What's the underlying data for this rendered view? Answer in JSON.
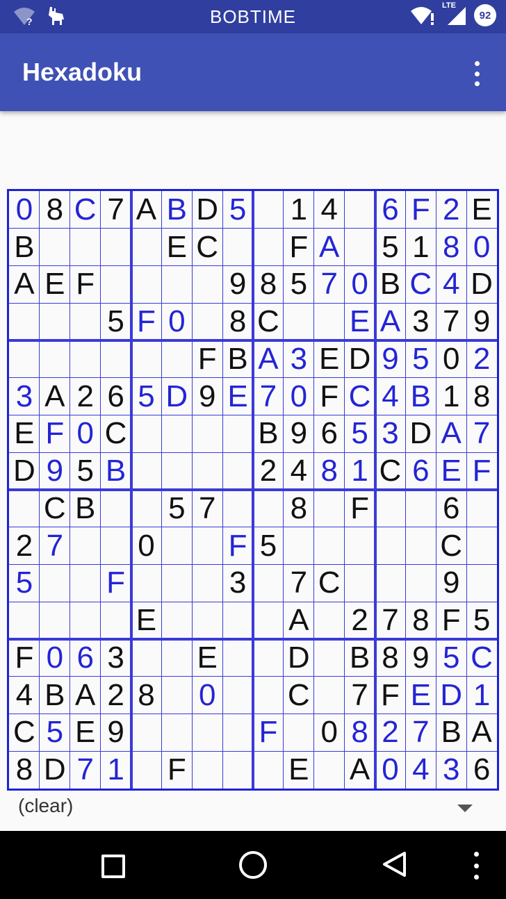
{
  "status_bar": {
    "title": "BOBTIME",
    "lte": "LTE",
    "battery": "92"
  },
  "app_bar": {
    "title": "Hexadoku"
  },
  "selector": {
    "value": "(clear)"
  },
  "colors": {
    "status_bar": "#303f9f",
    "app_bar": "#3f51b5",
    "grid": "#1e22d8",
    "given_digit": "#111111",
    "user_digit": "#2424d6"
  },
  "grid": {
    "size": 16,
    "box": 4,
    "rows": [
      [
        "0u",
        "8",
        "Cu",
        "7",
        "A",
        "Bu",
        "D",
        "5u",
        "",
        "1",
        "4",
        "",
        "6u",
        "Fu",
        "2u",
        "E"
      ],
      [
        "B",
        "",
        "",
        "",
        "",
        "E",
        "C",
        "",
        "",
        "F",
        "Au",
        "",
        "5",
        "1",
        "8u",
        "0u"
      ],
      [
        "A",
        "E",
        "F",
        "",
        "",
        "",
        "",
        "9",
        "8",
        "5",
        "7u",
        "0u",
        "B",
        "Cu",
        "4u",
        "D"
      ],
      [
        "",
        "",
        "",
        "5",
        "Fu",
        "0u",
        "",
        "8",
        "C",
        "",
        "",
        "Eu",
        "Au",
        "3",
        "7",
        "9"
      ],
      [
        "",
        "",
        "",
        "",
        "",
        "",
        "F",
        "B",
        "Au",
        "3u",
        "E",
        "D",
        "9u",
        "5u",
        "0",
        "2u"
      ],
      [
        "3u",
        "A",
        "2",
        "6",
        "5u",
        "Du",
        "9",
        "Eu",
        "7u",
        "0u",
        "F",
        "Cu",
        "4u",
        "Bu",
        "1",
        "8"
      ],
      [
        "E",
        "Fu",
        "0u",
        "C",
        "",
        "",
        "",
        "",
        "B",
        "9",
        "6",
        "5u",
        "3u",
        "D",
        "Au",
        "7u"
      ],
      [
        "D",
        "9u",
        "5",
        "Bu",
        "",
        "",
        "",
        "",
        "2",
        "4",
        "8u",
        "1u",
        "C",
        "6u",
        "Eu",
        "Fu"
      ],
      [
        "",
        "C",
        "B",
        "",
        "",
        "5",
        "7",
        "",
        "",
        "8",
        "",
        "F",
        "",
        "",
        "6",
        ""
      ],
      [
        "2",
        "7u",
        "",
        "",
        "0",
        "",
        "",
        "Fu",
        "5",
        "",
        "",
        "",
        "",
        "",
        "C",
        ""
      ],
      [
        "5u",
        "",
        "",
        "Fu",
        "",
        "",
        "",
        "3",
        "",
        "7",
        "C",
        "",
        "",
        "",
        "9",
        ""
      ],
      [
        "",
        "",
        "",
        "",
        "E",
        "",
        "",
        "",
        "",
        "A",
        "",
        "2",
        "7",
        "8",
        "F",
        "5"
      ],
      [
        "F",
        "0u",
        "6u",
        "3",
        "",
        "",
        "E",
        "",
        "",
        "D",
        "",
        "B",
        "8",
        "9",
        "5u",
        "Cu"
      ],
      [
        "4",
        "B",
        "A",
        "2",
        "8",
        "",
        "0u",
        "",
        "",
        "C",
        "",
        "7",
        "F",
        "Eu",
        "Du",
        "1u"
      ],
      [
        "C",
        "5u",
        "E",
        "9",
        "",
        "",
        "",
        "",
        "Fu",
        "",
        "0",
        "8u",
        "2u",
        "7u",
        "B",
        "A"
      ],
      [
        "8",
        "D",
        "7u",
        "1u",
        "",
        "F",
        "",
        "",
        "",
        "E",
        "",
        "A",
        "0u",
        "4u",
        "3u",
        "6"
      ]
    ]
  }
}
